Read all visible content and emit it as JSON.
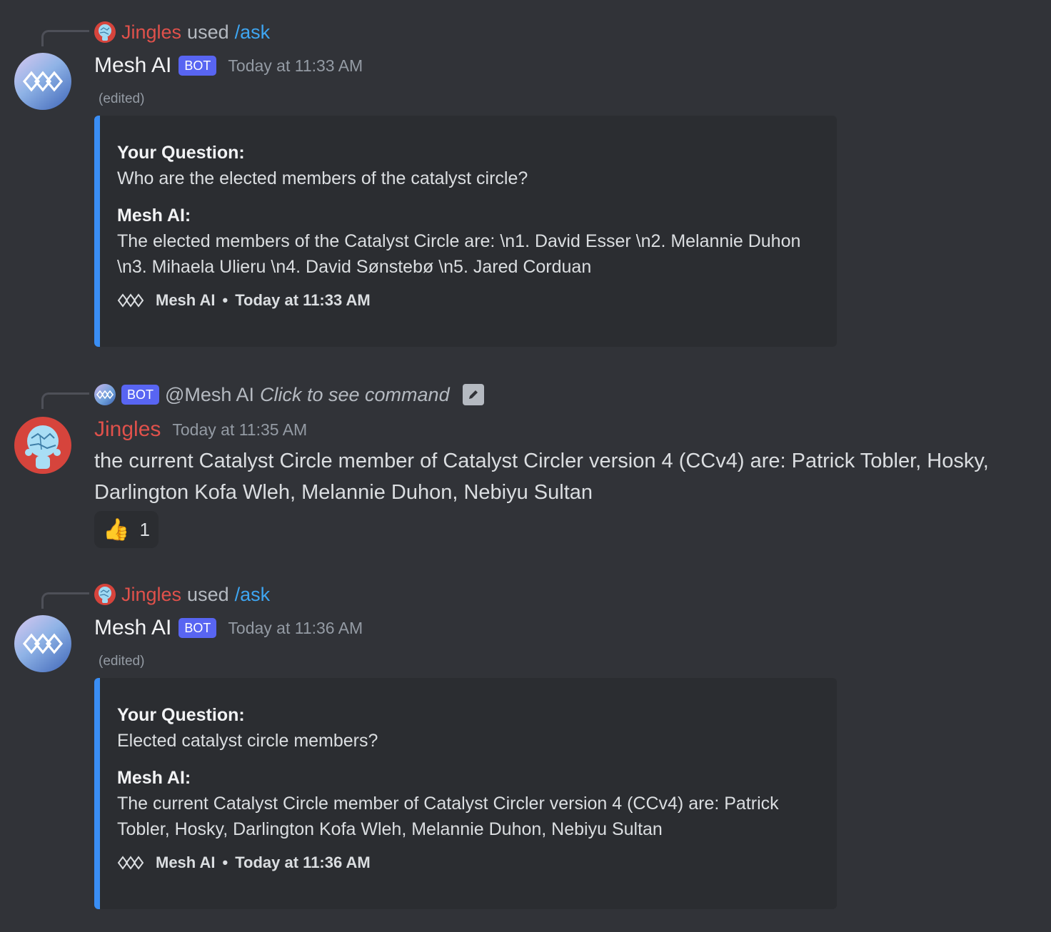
{
  "messages": [
    {
      "ref": {
        "user": "Jingles",
        "used": "used",
        "command": "/ask"
      },
      "author": "Mesh AI",
      "bot_tag": "BOT",
      "timestamp": "Today at 11:33 AM",
      "edited": "(edited)",
      "embed": {
        "q_label": "Your Question:",
        "q_text": "Who are the elected members of the catalyst circle?",
        "a_label": "Mesh AI:",
        "a_text": "The elected members of the Catalyst Circle are: \\n1. David Esser \\n2. Melannie Duhon \\n3. Mihaela Ulieru \\n4. David Sønstebø \\n5. Jared Corduan",
        "footer_name": "Mesh AI",
        "footer_sep": "•",
        "footer_time": "Today at 11:33 AM"
      }
    },
    {
      "ref": {
        "bot_tag": "BOT",
        "mention": "@Mesh AI",
        "hint": "Click to see command"
      },
      "author": "Jingles",
      "timestamp": "Today at 11:35 AM",
      "content": "the current Catalyst Circle member of Catalyst Circler version 4 (CCv4) are: Patrick Tobler, Hosky, Darlington Kofa Wleh, Melannie Duhon, Nebiyu Sultan",
      "reaction": {
        "emoji": "👍",
        "count": "1"
      }
    },
    {
      "ref": {
        "user": "Jingles",
        "used": "used",
        "command": "/ask"
      },
      "author": "Mesh AI",
      "bot_tag": "BOT",
      "timestamp": "Today at 11:36 AM",
      "edited": "(edited)",
      "embed": {
        "q_label": "Your Question:",
        "q_text": "Elected catalyst circle members?",
        "a_label": "Mesh AI:",
        "a_text": "The current Catalyst Circle member of Catalyst Circler version 4 (CCv4) are: Patrick Tobler, Hosky, Darlington Kofa Wleh, Melannie Duhon, Nebiyu Sultan",
        "footer_name": "Mesh AI",
        "footer_sep": "•",
        "footer_time": "Today at 11:36 AM"
      }
    }
  ],
  "colors": {
    "background": "#313338",
    "embed_bg": "#2b2d31",
    "embed_accent": "#3a8ef5",
    "bot_tag": "#5865f2",
    "jingles": "#e0514b",
    "command": "#3ea6f2"
  },
  "icons": [
    "mesh-logo-icon",
    "jingles-avatar-icon",
    "pencil-icon",
    "thumbs-up-emoji"
  ]
}
